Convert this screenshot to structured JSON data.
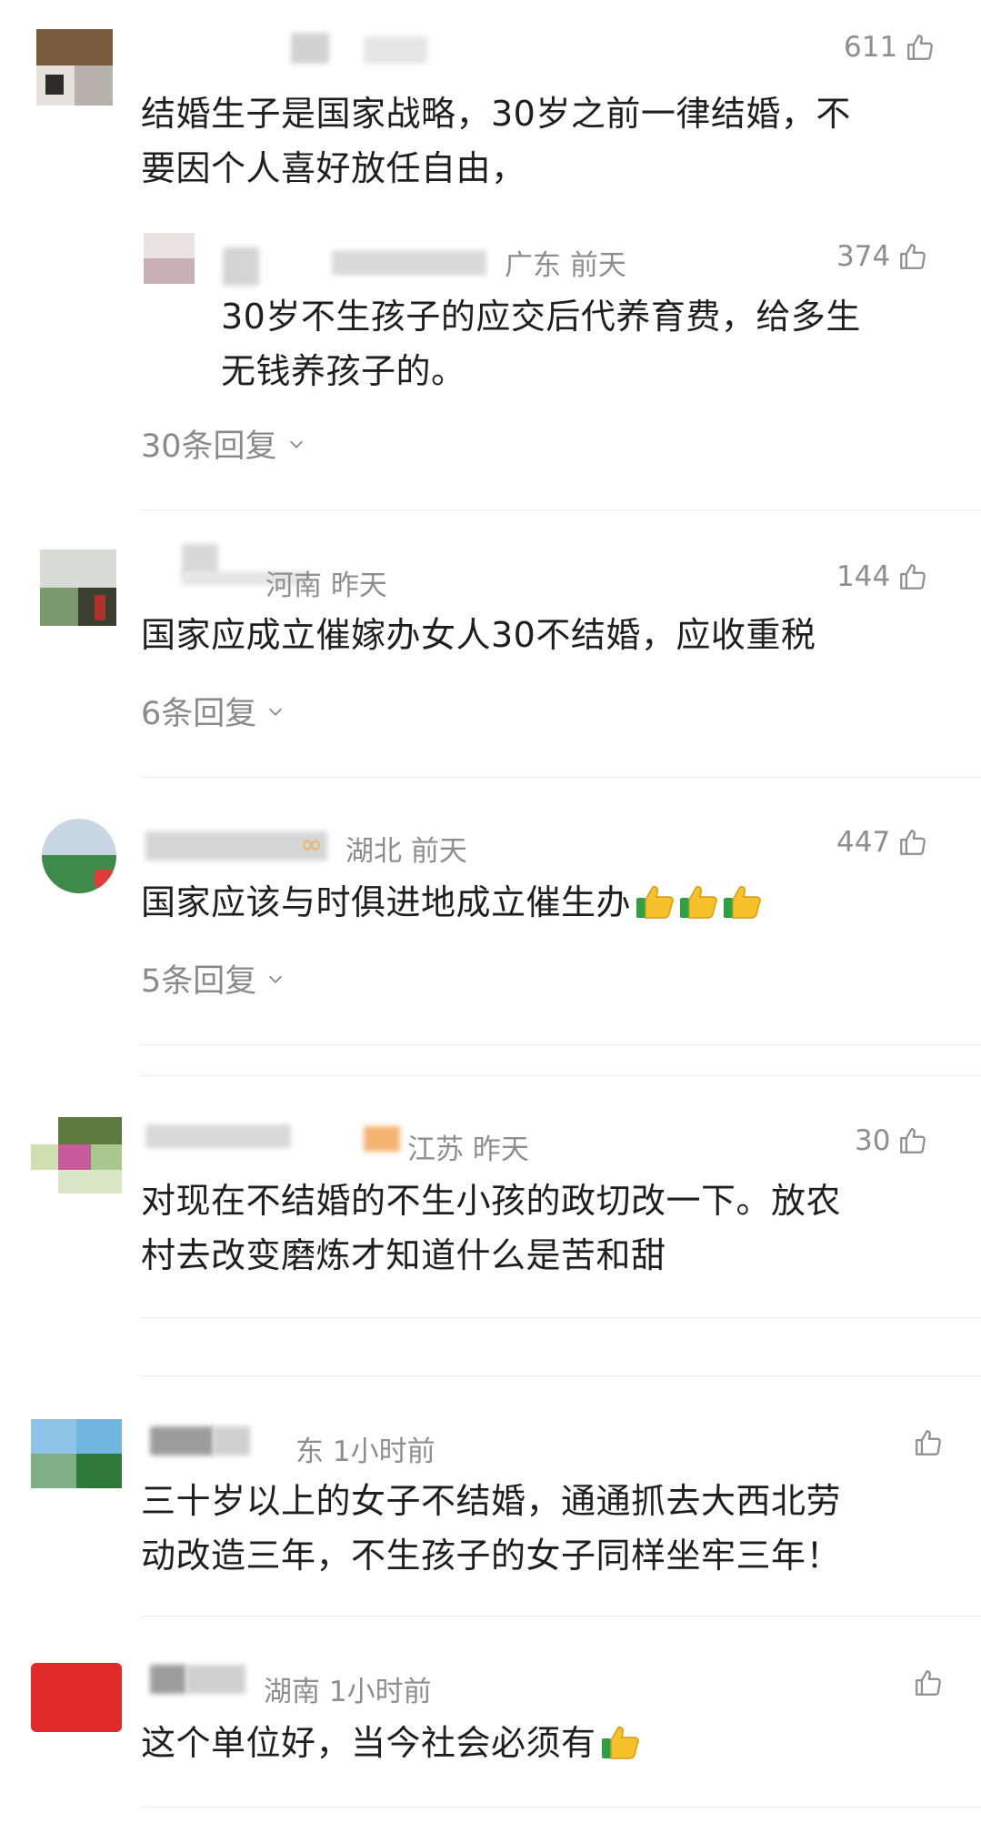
{
  "comments": [
    {
      "meta": "",
      "likes": "611",
      "text_lines": [
        "结婚生子是国家战略，30岁之前一律结婚，不",
        "要因个人喜好放任自由，"
      ],
      "sub_reply": {
        "meta": "广东  前天",
        "likes": "374",
        "text_lines": [
          "30岁不生孩子的应交后代养育费，给多生",
          "无钱养孩子的。"
        ]
      },
      "reply_count": "30条回复"
    },
    {
      "meta": "河南  昨天",
      "likes": "144",
      "text_lines": [
        "国家应成立催嫁办女人30不结婚，应收重税"
      ],
      "reply_count": "6条回复"
    },
    {
      "meta": "湖北  前天",
      "likes": "447",
      "text_lines": [
        "国家应该与时俱进地成立催生办"
      ],
      "reply_count": "5条回复"
    },
    {
      "meta": "江苏  昨天",
      "likes": "30",
      "text_lines": [
        "对现在不结婚的不生小孩的政切改一下。放农",
        "村去改变磨炼才知道什么是苦和甜"
      ]
    },
    {
      "meta": "东  1小时前",
      "likes": "",
      "text_lines": [
        "三十岁以上的女子不结婚，通通抓去大西北劳",
        "动改造三年，不生孩子的女子同样坐牢三年！"
      ]
    },
    {
      "meta": "湖南  1小时前",
      "likes": "",
      "text_lines": [
        "这个单位好，当今社会必须有"
      ]
    }
  ],
  "icons": {
    "like": "thumbs-up-outline-icon",
    "emoji": "thumbs-up-emoji-icon",
    "chevron": "chevron-down-icon"
  }
}
